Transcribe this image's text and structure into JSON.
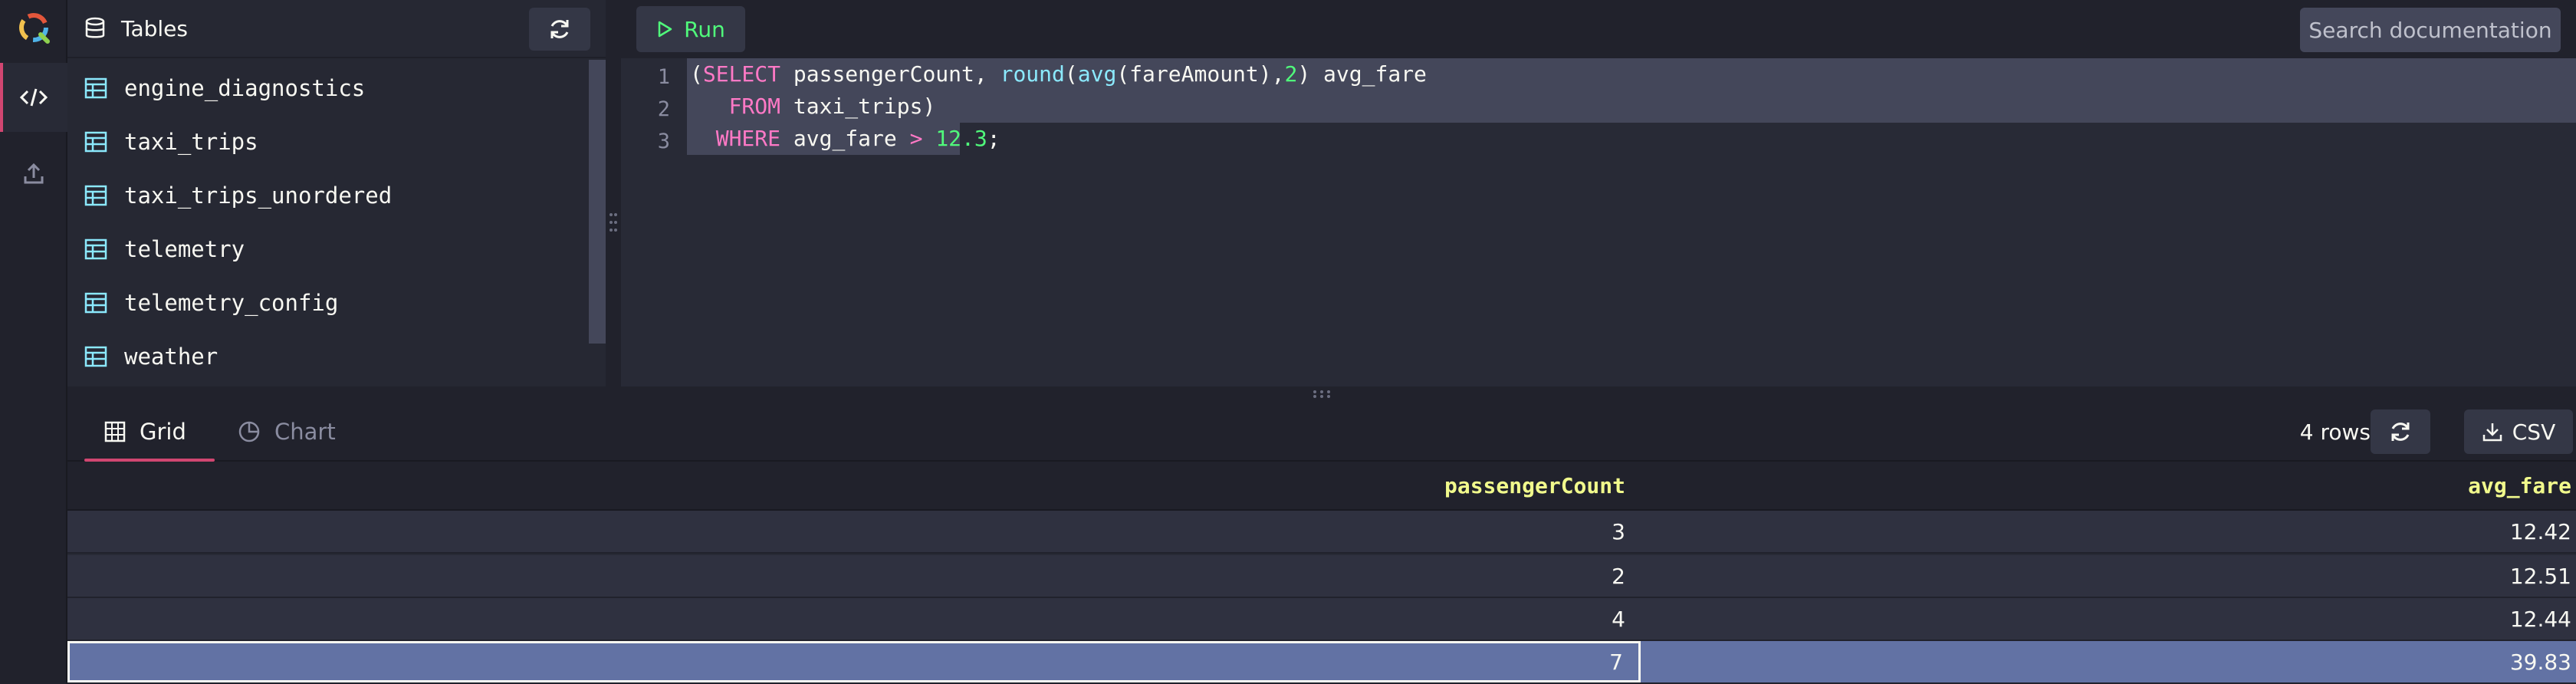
{
  "sidebar": {
    "title": "Tables",
    "tables": [
      "engine_diagnostics",
      "taxi_trips",
      "taxi_trips_unordered",
      "telemetry",
      "telemetry_config",
      "weather"
    ]
  },
  "toolbar": {
    "run_label": "Run",
    "search_label": "Search documentation"
  },
  "editor": {
    "line_numbers": [
      "1",
      "2",
      "3"
    ],
    "lines": [
      [
        {
          "t": "(",
          "c": "id"
        },
        {
          "t": "SELECT",
          "c": "kw"
        },
        {
          "t": " passengerCount, ",
          "c": "id"
        },
        {
          "t": "round",
          "c": "fn"
        },
        {
          "t": "(",
          "c": "id"
        },
        {
          "t": "avg",
          "c": "fn"
        },
        {
          "t": "(fareAmount),",
          "c": "id"
        },
        {
          "t": "2",
          "c": "num"
        },
        {
          "t": ") avg_fare",
          "c": "id"
        }
      ],
      [
        {
          "t": "   ",
          "c": "id"
        },
        {
          "t": "FROM",
          "c": "kw"
        },
        {
          "t": " taxi_trips)",
          "c": "id"
        }
      ],
      [
        {
          "t": "  ",
          "c": "id"
        },
        {
          "t": "WHERE",
          "c": "kw"
        },
        {
          "t": " avg_fare ",
          "c": "id"
        },
        {
          "t": ">",
          "c": "kw"
        },
        {
          "t": " ",
          "c": "id"
        },
        {
          "t": "12.3",
          "c": "num"
        },
        {
          "t": ";",
          "c": "id"
        }
      ]
    ]
  },
  "results": {
    "tabs": [
      "Grid",
      "Chart"
    ],
    "active_tab": "Grid",
    "row_count": "4 rows",
    "csv_label": "CSV",
    "columns": [
      "passengerCount",
      "avg_fare"
    ],
    "rows": [
      [
        "3",
        "12.42"
      ],
      [
        "2",
        "12.51"
      ],
      [
        "4",
        "12.44"
      ],
      [
        "7",
        "39.83"
      ]
    ],
    "selected_row": 3
  },
  "colors": {
    "accent": "#d14671",
    "keyword": "#ff79c6",
    "function": "#8be9fd",
    "number": "#50fa7b",
    "header_text": "#f1fa8c",
    "selection": "#6272a4"
  }
}
